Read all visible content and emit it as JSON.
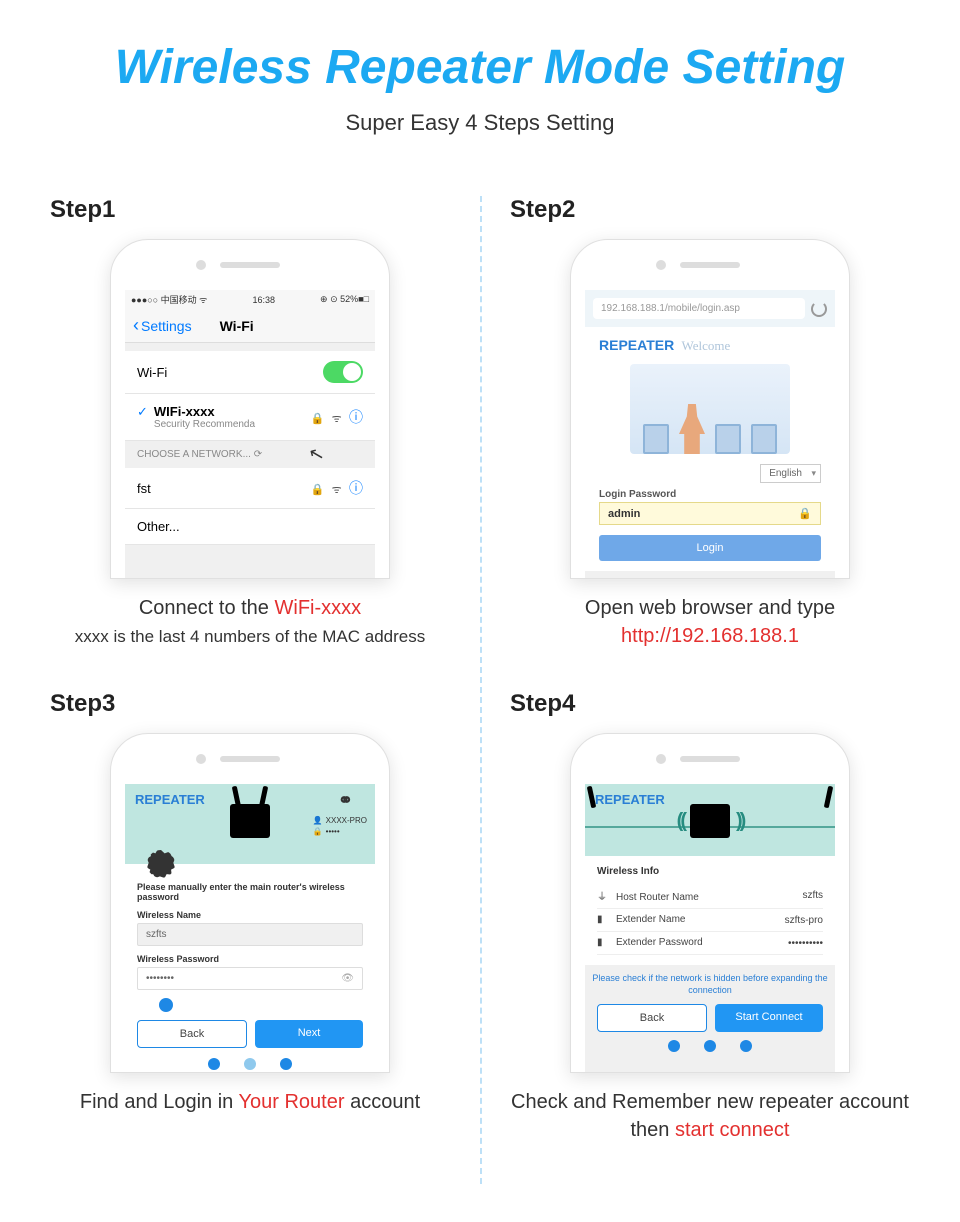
{
  "title": "Wireless Repeater Mode Setting",
  "subtitle": "Super Easy 4 Steps Setting",
  "steps": {
    "s1": {
      "label": "Step1",
      "caption_pre": "Connect to the ",
      "caption_red": "WiFi-xxxx",
      "caption_sub": "xxxx is the last 4 numbers of the MAC address",
      "statusbar": {
        "carrier": "●●●○○ 中国移动 ᯤ",
        "time": "16:38",
        "right": "⊕ ⊙ 52%■□"
      },
      "nav": {
        "back": "Settings",
        "title": "Wi-Fi"
      },
      "wifi_label": "Wi-Fi",
      "connected": {
        "ssid": "WIFi-xxxx",
        "note": "Security Recommenda"
      },
      "choose": "CHOOSE A NETWORK...",
      "networks": [
        "fst",
        "Other..."
      ]
    },
    "s2": {
      "label": "Step2",
      "caption_pre": "Open web browser and type",
      "caption_red": "http://192.168.188.1",
      "url": "192.168.188.1/mobile/login.asp",
      "brand": "REPEATER",
      "welcome": "Welcome",
      "lang": "English",
      "login_label": "Login Password",
      "password": "admin",
      "login_btn": "Login"
    },
    "s3": {
      "label": "Step3",
      "caption_a": "Find and Login in ",
      "caption_red": "Your Router",
      "caption_b": " account",
      "brand": "REPEATER",
      "creds": {
        "ssid": "XXXX-PRO",
        "pwd": "•••••"
      },
      "instruction": "Please manually enter the main router's wireless password",
      "name_label": "Wireless Name",
      "name_value": "szfts",
      "pwd_label": "Wireless Password",
      "pwd_value": "••••••••",
      "back": "Back",
      "next": "Next"
    },
    "s4": {
      "label": "Step4",
      "caption_a": "Check and Remember new repeater account then ",
      "caption_red": "start connect",
      "brand": "REPEATER",
      "section": "Wireless Info",
      "rows": {
        "host": {
          "label": "Host Router Name",
          "value": "szfts"
        },
        "ext": {
          "label": "Extender Name",
          "value": "szfts-pro"
        },
        "pwd": {
          "label": "Extender Password",
          "value": "••••••••••"
        }
      },
      "note": "Please check if the network is hidden before expanding the connection",
      "back": "Back",
      "start": "Start Connect"
    }
  }
}
